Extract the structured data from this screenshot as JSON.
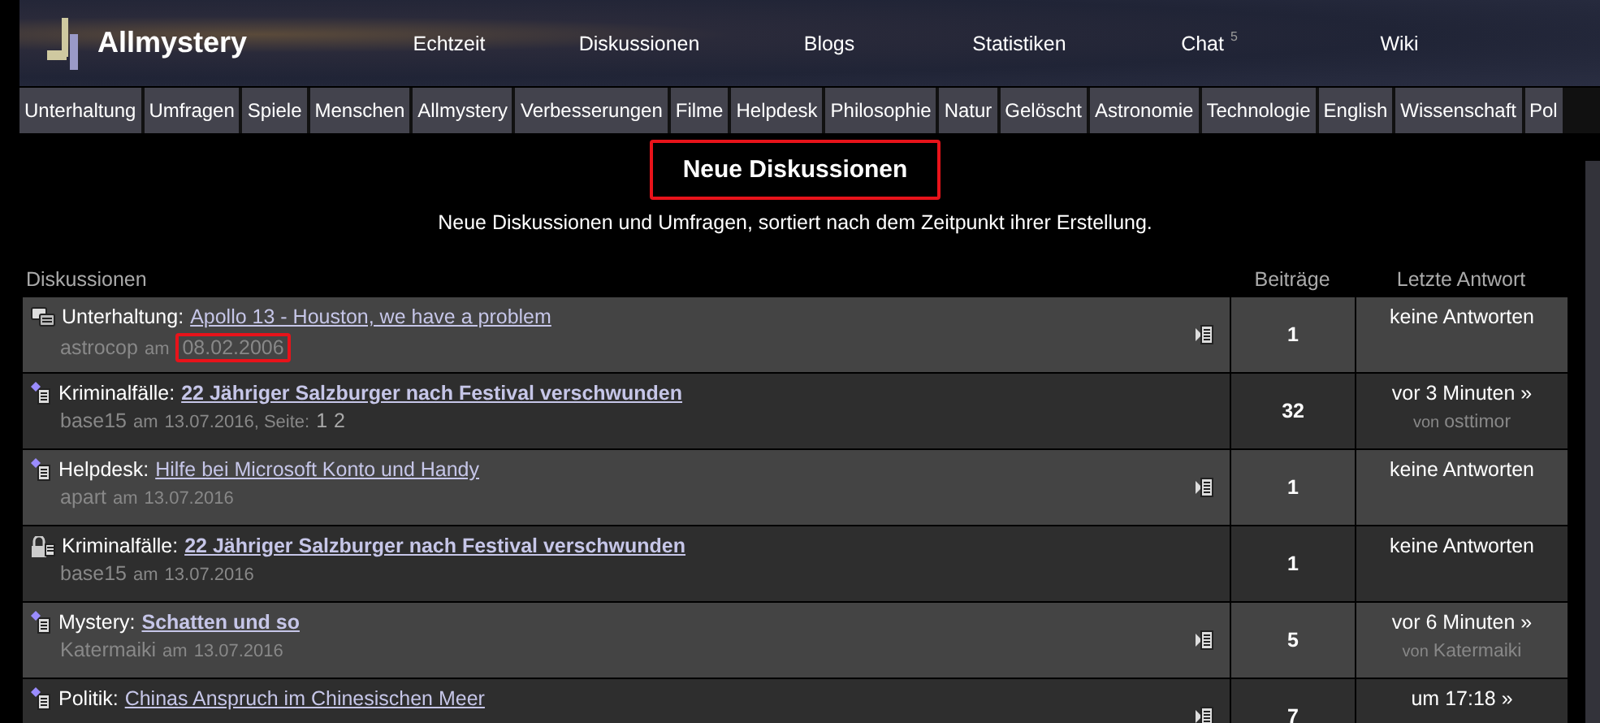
{
  "header": {
    "logo": "Allmystery",
    "nav": [
      {
        "label": "Echtzeit"
      },
      {
        "label": "Diskussionen"
      },
      {
        "label": "Blogs"
      },
      {
        "label": "Statistiken"
      },
      {
        "label": "Chat",
        "badge": "5"
      },
      {
        "label": "Wiki"
      }
    ]
  },
  "categories": [
    "Unterhaltung",
    "Umfragen",
    "Spiele",
    "Menschen",
    "Allmystery",
    "Verbesserungen",
    "Filme",
    "Helpdesk",
    "Philosophie",
    "Natur",
    "Gelöscht",
    "Astronomie",
    "Technologie",
    "English",
    "Wissenschaft",
    "Pol"
  ],
  "page": {
    "title": "Neue Diskussionen",
    "subtitle": "Neue Diskussionen und Umfragen, sortiert nach dem Zeitpunkt ihrer Erstellung."
  },
  "table": {
    "columns": [
      "Diskussionen",
      "Beiträge",
      "Letzte Antwort"
    ],
    "rows": [
      {
        "kind": "discussion",
        "category": "Unterhaltung:",
        "title": "Apollo 13 - Houston, we have a problem",
        "bold": false,
        "user": "astrocop",
        "am": "am",
        "date": "08.02.2006",
        "date_highlighted": true,
        "side_icon": true,
        "posts": "1",
        "last": "keine Antworten"
      },
      {
        "kind": "new",
        "category": "Kriminalfälle:",
        "title": "22 Jähriger Salzburger nach Festival verschwunden",
        "bold": true,
        "user": "base15",
        "am": "am",
        "date": "13.07.2016, Seite:",
        "date_highlighted": false,
        "pages": [
          "1",
          "2"
        ],
        "side_icon": false,
        "posts": "32",
        "last": "vor 3 Minuten »",
        "von": "von",
        "last_user": "osttimor"
      },
      {
        "kind": "new",
        "category": "Helpdesk:",
        "title": "Hilfe bei Microsoft Konto und Handy",
        "bold": false,
        "user": "apart",
        "am": "am",
        "date": "13.07.2016",
        "date_highlighted": false,
        "side_icon": true,
        "posts": "1",
        "last": "keine Antworten"
      },
      {
        "kind": "locked",
        "category": "Kriminalfälle:",
        "title": "22 Jähriger Salzburger nach Festival verschwunden",
        "bold": true,
        "user": "base15",
        "am": "am",
        "date": "13.07.2016",
        "date_highlighted": false,
        "side_icon": false,
        "posts": "1",
        "last": "keine Antworten"
      },
      {
        "kind": "new",
        "category": "Mystery:",
        "title": "Schatten und so",
        "bold": true,
        "user": "Katermaiki",
        "am": "am",
        "date": "13.07.2016",
        "date_highlighted": false,
        "side_icon": true,
        "posts": "5",
        "last": "vor 6 Minuten »",
        "von": "von",
        "last_user": "Katermaiki"
      },
      {
        "kind": "new",
        "category": "Politik:",
        "title": "Chinas Anspruch im Chinesischen Meer",
        "bold": false,
        "side_icon": true,
        "posts": "7",
        "last": "um 17:18 »"
      }
    ]
  }
}
